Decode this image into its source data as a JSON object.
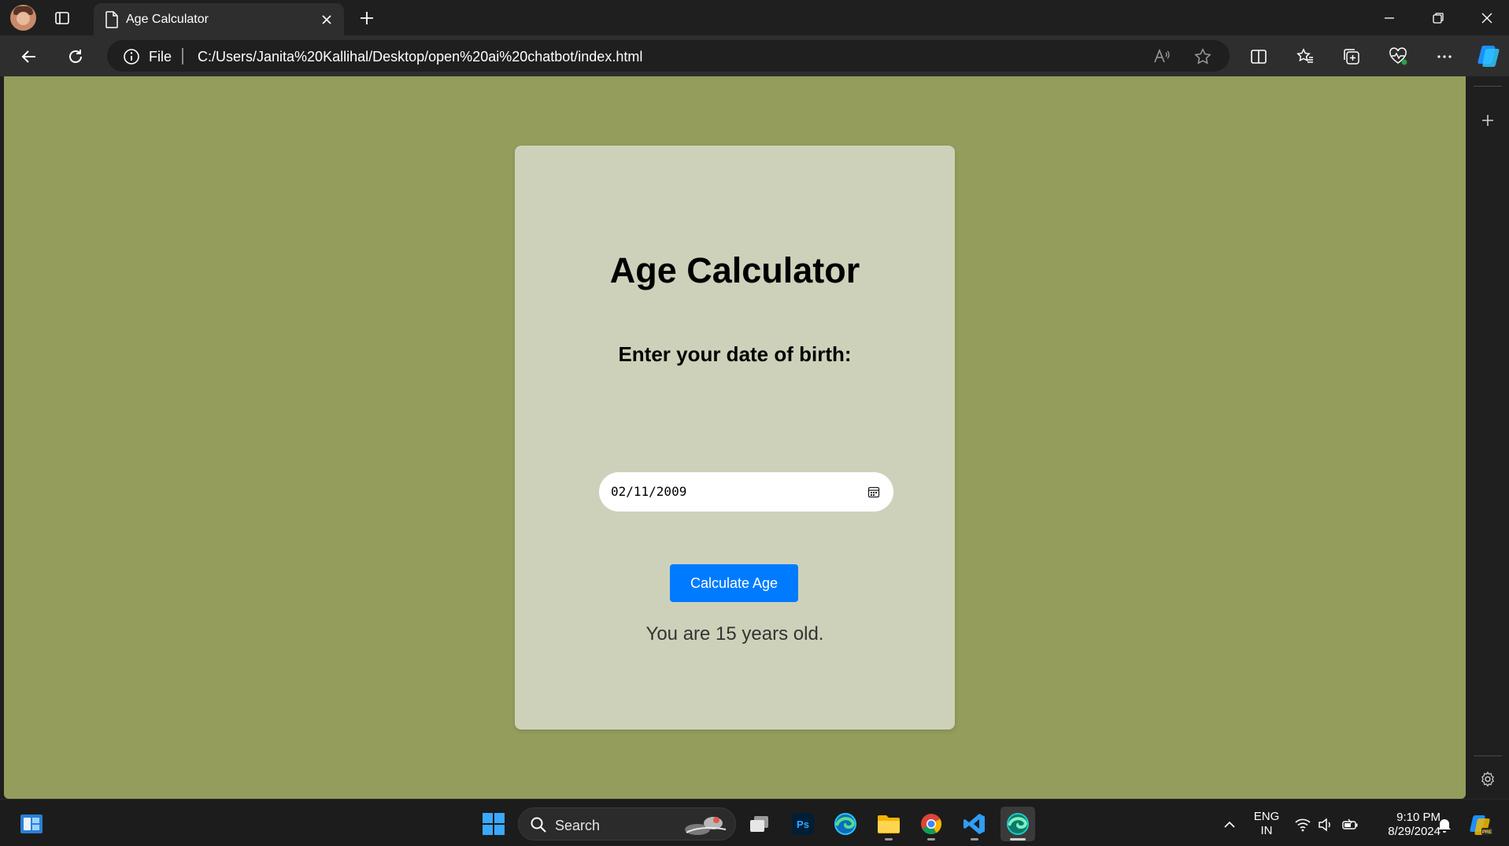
{
  "browser": {
    "tab_title": "Age Calculator",
    "file_label": "File",
    "url": "C:/Users/Janita%20Kallihal/Desktop/open%20ai%20chatbot/index.html"
  },
  "page": {
    "heading": "Age Calculator",
    "dob_label": "Enter your date of birth:",
    "dob_value": "02/11/2009",
    "button_label": "Calculate Age",
    "result_text": "You are 15 years old.",
    "colors": {
      "background": "#949d5c",
      "card": "#ced1b9",
      "button": "#007bff"
    }
  },
  "taskbar": {
    "search_placeholder": "Search",
    "language": "ENG",
    "region": "IN",
    "time": "9:10 PM",
    "date": "8/29/2024"
  }
}
